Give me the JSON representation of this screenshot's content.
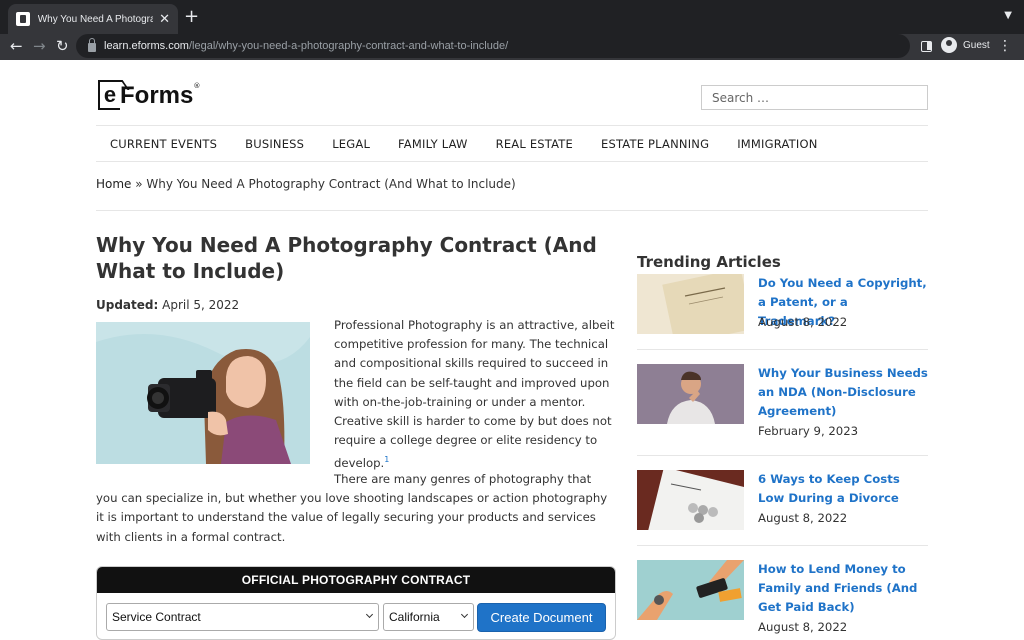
{
  "browser": {
    "tab_title": "Why You Need A Photography",
    "url_host": "learn.eforms.com",
    "url_path": "/legal/why-you-need-a-photography-contract-and-what-to-include/",
    "profile_name": "Guest"
  },
  "site": {
    "logo_e": "e",
    "logo_text": "Forms",
    "logo_reg": "®",
    "search_placeholder": "Search …",
    "nav": [
      "CURRENT EVENTS",
      "BUSINESS",
      "LEGAL",
      "FAMILY LAW",
      "REAL ESTATE",
      "ESTATE PLANNING",
      "IMMIGRATION"
    ]
  },
  "breadcrumb": {
    "home": "Home",
    "separator": " » ",
    "current": "Why You Need A Photography Contract (And What to Include)"
  },
  "article": {
    "title": "Why You Need A Photography Contract (And What to Include)",
    "updated_label": "Updated:",
    "updated_date": " April 5, 2022",
    "intro": "Professional Photography is an attractive, albeit competitive profession for many. The technical and compositional skills required to succeed in the field can be self-taught and improved upon with on-the-job-training or under a mentor. Creative skill is harder to come by but does not require a college degree or elite residency to develop.",
    "intro_footnote": "1",
    "para2": "There are many genres of photography that you can specialize in, but whether you love shooting landscapes or action photography it is important to understand the value of legally securing your products and services with clients in a formal contract."
  },
  "widget": {
    "heading": "OFFICIAL PHOTOGRAPHY CONTRACT",
    "contract_type": "Service Contract",
    "state": "California",
    "button": "Create Document"
  },
  "sidebar": {
    "title": "Trending Articles",
    "articles": [
      {
        "title": "Do You Need a Copyright, a Patent, or a Trademark?",
        "date": "August 8, 2022"
      },
      {
        "title": "Why Your Business Needs an NDA (Non-Disclosure Agreement)",
        "date": "February 9, 2023"
      },
      {
        "title": "6 Ways to Keep Costs Low During a Divorce",
        "date": "August 8, 2022"
      },
      {
        "title": "How to Lend Money to Family and Friends (And Get Paid Back)",
        "date": "August 8, 2022"
      }
    ]
  },
  "colors": {
    "link_blue": "#1f73c8",
    "chrome_dark": "#202124",
    "chrome_toolbar": "#35363a"
  }
}
